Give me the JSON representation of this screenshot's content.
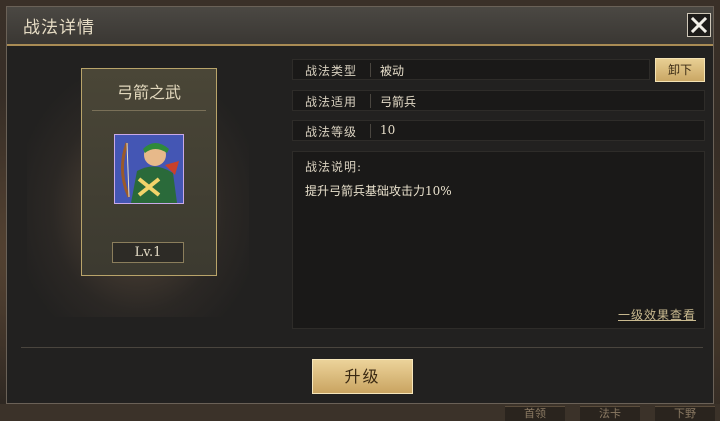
{
  "dialog": {
    "title": "战法详情"
  },
  "skill": {
    "name": "弓箭之武",
    "level": "Lv.1",
    "icon": "archer-general-portrait"
  },
  "info_rows": [
    {
      "label": "战法类型",
      "value": "被动"
    },
    {
      "label": "战法适用",
      "value": "弓箭兵"
    },
    {
      "label": "战法等级",
      "value": "10"
    }
  ],
  "buttons": {
    "unequip": "卸下",
    "upgrade": "升级"
  },
  "description": {
    "title": "战法说明:",
    "text": "提升弓箭兵基础攻击力10%",
    "link": "一级效果查看"
  },
  "background_tabs": [
    "首领",
    "法卡",
    "下野"
  ],
  "colors": {
    "accent_gold": "#caa765",
    "border_gold": "#a98b54",
    "panel_dark": "#1a1918"
  }
}
